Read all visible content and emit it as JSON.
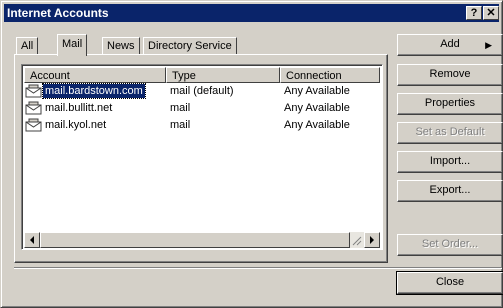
{
  "window": {
    "title": "Internet Accounts"
  },
  "titlebar_buttons": {
    "help": "?",
    "close": "✕"
  },
  "tabs": [
    {
      "label": "All",
      "active": false
    },
    {
      "label": "Mail",
      "active": true
    },
    {
      "label": "News",
      "active": false
    },
    {
      "label": "Directory Service",
      "active": false
    }
  ],
  "list": {
    "columns": [
      "Account",
      "Type",
      "Connection"
    ],
    "rows": [
      {
        "account": "mail.bardstown.com",
        "type": "mail (default)",
        "connection": "Any Available",
        "selected": true
      },
      {
        "account": "mail.bullitt.net",
        "type": "mail",
        "connection": "Any Available",
        "selected": false
      },
      {
        "account": "mail.kyol.net",
        "type": "mail",
        "connection": "Any Available",
        "selected": false
      }
    ],
    "icon": "mail-account-icon"
  },
  "buttons": {
    "add": "Add",
    "remove": "Remove",
    "properties": "Properties",
    "set_default": "Set as Default",
    "import": "Import...",
    "export": "Export...",
    "set_order": "Set Order...",
    "close": "Close"
  },
  "colors": {
    "titlebar": "#0a246a",
    "face": "#d4d0c8",
    "selection": "#0a246a"
  }
}
